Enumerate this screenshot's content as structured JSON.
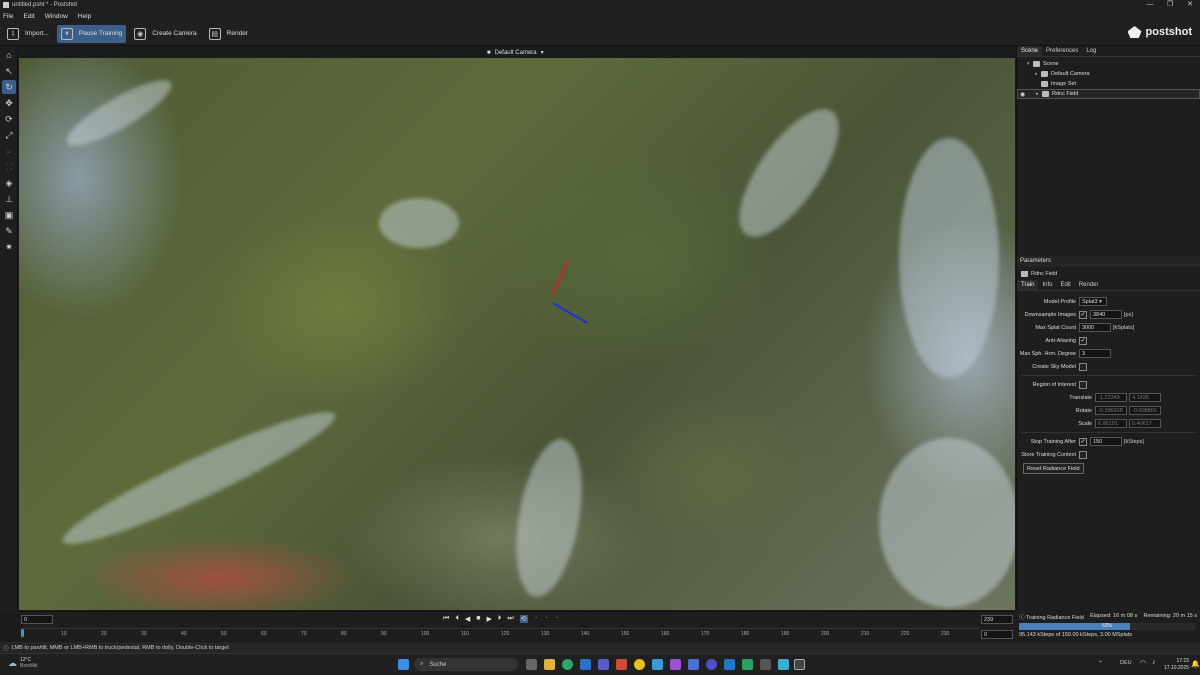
{
  "window": {
    "title": "untitled.psht * - Postshot",
    "min": "—",
    "max": "❐",
    "close": "✕"
  },
  "menu": [
    "File",
    "Edit",
    "Window",
    "Help"
  ],
  "toolbar": {
    "import": "Import...",
    "pause": "Pause Training",
    "create_camera": "Create Camera",
    "render": "Render"
  },
  "brand": "postshot",
  "viewport": {
    "camera": "Default Camera"
  },
  "scene_tabs": [
    "Scene",
    "Preferences",
    "Log"
  ],
  "scene_tree": [
    "Scene",
    "Default Camera",
    "Image Set",
    "Rdnc Field"
  ],
  "params": {
    "header": "Parameters",
    "object": "Rdnc Field",
    "tabs": [
      "Train",
      "Info",
      "Edit",
      "Render"
    ],
    "model_profile_label": "Model Profile",
    "model_profile": "Splat3",
    "downsample_label": "Downsample Images",
    "downsample": "3840",
    "downsample_unit": "[px]",
    "max_splat_label": "Max Splat Count",
    "max_splat": "3000",
    "max_splat_unit": "[kSplats]",
    "anti_alias_label": "Anti-Aliasing",
    "sph_label": "Max Sph. Hrm. Degree",
    "sph": "3",
    "sky_label": "Create Sky Model",
    "roi_label": "Region of Interest",
    "translate_label": "Translate",
    "translate": [
      "-1.23349",
      "4.1426"
    ],
    "rotate_label": "Rotate",
    "rotate": [
      "-0.396928",
      "-0.008866"
    ],
    "scale_label": "Scale",
    "scale": [
      "6.95191",
      "5.40617"
    ],
    "stop_label": "Stop Training After",
    "stop": "150",
    "stop_unit": "[kSteps]",
    "store_label": "Store Training Context",
    "reset": "Reset Radiance Field"
  },
  "timeline": {
    "start": "0",
    "end": "239",
    "current": "0",
    "ticks": [
      "0",
      "10",
      "20",
      "30",
      "40",
      "50",
      "60",
      "70",
      "80",
      "90",
      "100",
      "110",
      "120",
      "130",
      "140",
      "150",
      "160",
      "170",
      "180",
      "190",
      "200",
      "210",
      "220",
      "230"
    ]
  },
  "training": {
    "label": "Training Radiance Field",
    "elapsed": "Elapsed: 16 m 08 s",
    "remaining": "Remaining: 20 m 15 s",
    "progress_pct": 63,
    "progress_text": "63%",
    "steps": "95.143 kSteps of 150.00 kSteps, 3.00 MSplats"
  },
  "status": "LMB to pan/tilt, MMB or LMB+RMB to truck/pedestal, RMB to dolly, Double-Click to target",
  "taskbar": {
    "temp": "12°C",
    "weather": "Bewölkt",
    "search": "Suche",
    "lang": "DEU",
    "time": "17:15",
    "date": "17.10.2025"
  },
  "colors": {
    "accent": "#3b5f88",
    "progress": "#4b80b8"
  }
}
